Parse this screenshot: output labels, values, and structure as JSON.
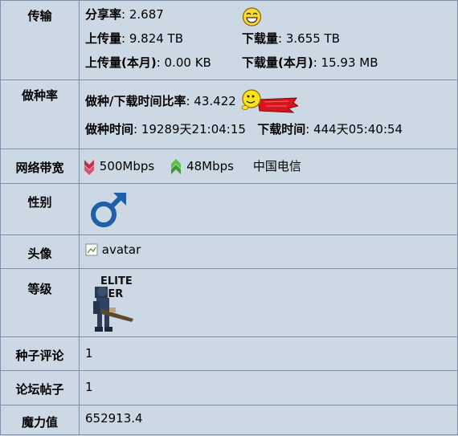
{
  "rows": {
    "transfer": {
      "label": "传输",
      "share_ratio_label": "分享率",
      "share_ratio": ": 2.687",
      "upload_label": "上传量",
      "upload": ": 9.824 TB",
      "download_label": "下载量",
      "download": ": 3.655 TB",
      "upload_month_label": "上传量(本月)",
      "upload_month": ": 0.00 KB",
      "download_month_label": "下载量(本月)",
      "download_month": ": 15.93 MB",
      "smiley_icon": "laughing-smiley-icon"
    },
    "seeding": {
      "label": "做种率",
      "ratio_label": "做种/下载时间比率",
      "ratio": ": 43.422",
      "seed_time_label": "做种时间",
      "seed_time": ": 19289天21:04:15",
      "dl_time_label": "下载时间",
      "dl_time": ": 444天05:40:54",
      "flying_icon": "flying-superhero-smiley-icon"
    },
    "bandwidth": {
      "label": "网络带宽",
      "down": "500Mbps",
      "up": "48Mbps",
      "isp": "中国电信",
      "down_color": "#c0304a",
      "up_color": "#3d9a2e"
    },
    "gender": {
      "label": "性别",
      "icon": "male-symbol-icon",
      "color": "#1e5fa8"
    },
    "avatar": {
      "label": "头像",
      "alt": "avatar"
    },
    "class": {
      "label": "等级",
      "badge_line1": "ELITE",
      "badge_line2": "SER"
    },
    "torrent_comments": {
      "label": "种子评论",
      "value": "1"
    },
    "forum_posts": {
      "label": "论坛帖子",
      "value": "1"
    },
    "bonus": {
      "label": "魔力值",
      "value": "652913.4"
    }
  }
}
